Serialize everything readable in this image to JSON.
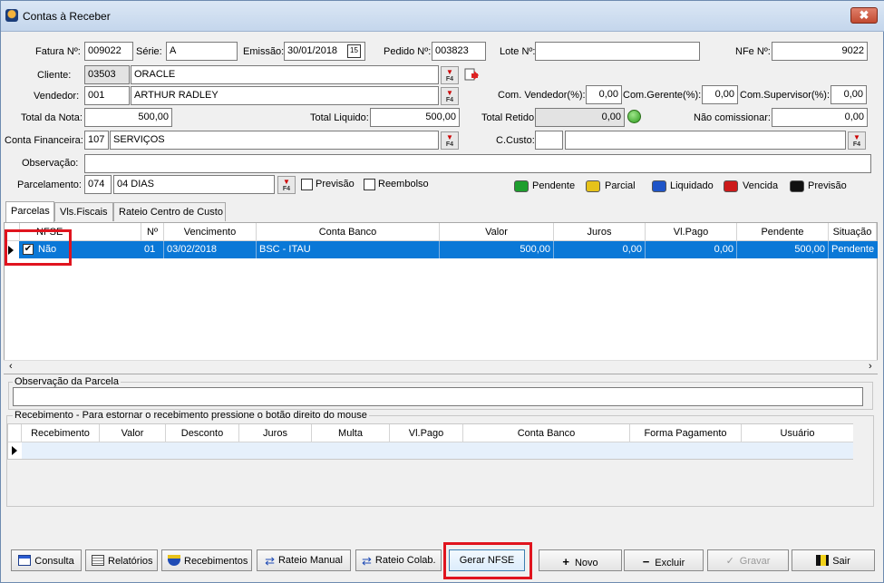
{
  "window": {
    "title": "Contas à Receber",
    "close": "✖"
  },
  "header": {
    "fatura_label": "Fatura Nº:",
    "fatura": "009022",
    "serie_label": "Série:",
    "serie": "A",
    "emissao_label": "Emissão:",
    "emissao": "30/01/2018",
    "calendar_glyph": "15",
    "pedido_label": "Pedido Nº:",
    "pedido": "003823",
    "lote_label": "Lote Nº:",
    "lote": "",
    "nfe_label": "NFe Nº:",
    "nfe": "9022",
    "cliente_label": "Cliente:",
    "cliente_code": "03503",
    "cliente_name": "ORACLE",
    "vendedor_label": "Vendedor:",
    "vendedor_code": "001",
    "vendedor_name": "ARTHUR RADLEY",
    "com_vendedor_label": "Com. Vendedor(%):",
    "com_vendedor": "0,00",
    "com_gerente_label": "Com.Gerente(%):",
    "com_gerente": "0,00",
    "com_supervisor_label": "Com.Supervisor(%):",
    "com_supervisor": "0,00",
    "total_nota_label": "Total da Nota:",
    "total_nota": "500,00",
    "total_liquido_label": "Total Liquido:",
    "total_liquido": "500,00",
    "total_retido_label": "Total Retido:",
    "total_retido": "0,00",
    "nao_comissionar_label": "Não comissionar:",
    "nao_comissionar": "0,00",
    "conta_fin_label": "Conta Financeira:",
    "conta_fin_code": "107",
    "conta_fin_name": "SERVIÇOS",
    "ccusto_label": "C.Custo:",
    "ccusto_code": "",
    "ccusto_name": "",
    "obs_label": "Observação:",
    "obs": "",
    "parcelamento_label": "Parcelamento:",
    "parc_code": "074",
    "parc_name": "04 DIAS",
    "previsao_label": "Previsão",
    "reembolso_label": "Reembolso",
    "f4": "F4"
  },
  "legend": [
    {
      "label": "Pendente",
      "color": "#1e9e2e"
    },
    {
      "label": "Parcial",
      "color": "#e6c21a"
    },
    {
      "label": "Liquidado",
      "color": "#1f55c8"
    },
    {
      "label": "Vencida",
      "color": "#cc1b1b"
    },
    {
      "label": "Previsão",
      "color": "#111111"
    }
  ],
  "tabs": [
    "Parcelas",
    "Vls.Fiscais",
    "Rateio Centro de Custo"
  ],
  "parcelas": {
    "columns": [
      "NFSE",
      "Nº",
      "Vencimento",
      "Conta Banco",
      "Valor",
      "Juros",
      "Vl.Pago",
      "Pendente",
      "Situação"
    ],
    "row": {
      "nfse": "Não",
      "num": "01",
      "vencimento": "03/02/2018",
      "conta": "BSC - ITAU",
      "valor": "500,00",
      "juros": "0,00",
      "pago": "0,00",
      "pendente": "500,00",
      "situacao": "Pendente"
    }
  },
  "obs_parcela_label": "Observação da Parcela",
  "recebimento": {
    "title": "Recebimento - Para estornar o recebimento pressione o botão direito do mouse",
    "columns": [
      "Recebimento",
      "Valor",
      "Desconto",
      "Juros",
      "Multa",
      "Vl.Pago",
      "Conta Banco",
      "Forma Pagamento",
      "Usuário"
    ]
  },
  "buttons": {
    "consulta": "Consulta",
    "relatorios": "Relatórios",
    "recebimentos": "Recebimentos",
    "rateio_manual": "Rateio Manual",
    "rateio_colab": "Rateio Colab.",
    "gerar_nfse": "Gerar NFSE",
    "novo": "Novo",
    "excluir": "Excluir",
    "gravar": "Gravar",
    "sair": "Sair"
  }
}
